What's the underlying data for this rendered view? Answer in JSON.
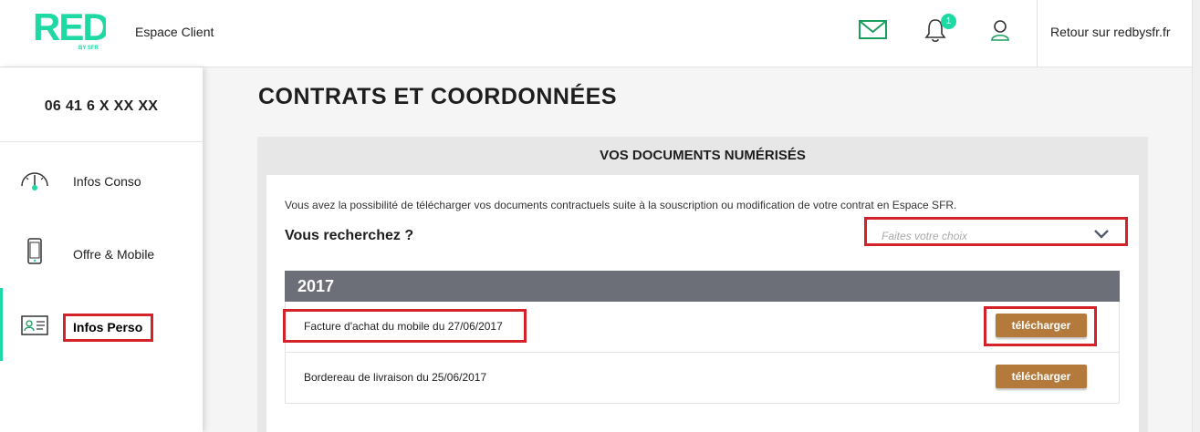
{
  "header": {
    "logo_text": "RED",
    "logo_sub": "BY SFR",
    "espace_label": "Espace Client",
    "notification_count": "1",
    "retour_label": "Retour sur redbysfr.fr"
  },
  "sidebar": {
    "phone_number": "06 41 6 X  XX  XX",
    "items": [
      {
        "label": "Infos Conso",
        "icon": "gauge-icon"
      },
      {
        "label": "Offre & Mobile",
        "icon": "mobile-phone-icon"
      },
      {
        "label": "Infos Perso",
        "icon": "id-card-icon",
        "active": true
      }
    ]
  },
  "main": {
    "page_title": "CONTRATS ET COORDONNÉES",
    "card_title": "VOS DOCUMENTS NUMÉRISÉS",
    "intro_text": "Vous avez la possibilité de télécharger vos documents contractuels suite à la souscription ou modification de votre contrat en Espace SFR.",
    "search_label": "Vous recherchez ?",
    "select_placeholder": "Faites votre choix",
    "year": "2017",
    "documents": [
      {
        "name": "Facture d'achat du mobile du 27/06/2017",
        "button": "télécharger"
      },
      {
        "name": "Bordereau de livraison du 25/06/2017",
        "button": "télécharger"
      }
    ]
  },
  "colors": {
    "brand_green": "#1ed9a3",
    "download_button": "#b37a3c",
    "year_bar": "#6c6e78",
    "highlight_red": "#d3222a"
  }
}
